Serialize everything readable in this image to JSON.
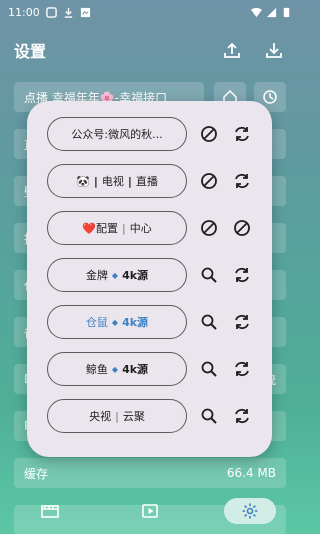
{
  "status_bar": {
    "time": "11:00"
  },
  "header": {
    "title": "设置"
  },
  "settings_rows": [
    {
      "label": "点播     幸福年年🌸-幸福接口"
    },
    {
      "label": "直"
    },
    {
      "label": "壁"
    },
    {
      "label": "推"
    },
    {
      "label": "代"
    },
    {
      "label": "备"
    },
    {
      "label": "D",
      "value": "统"
    },
    {
      "label": "P"
    },
    {
      "label": "缓存",
      "value": "66.4 MB"
    }
  ],
  "modal": {
    "items": [
      {
        "name": "公众号:微风的秋..."
      },
      {
        "prefix": "🐼",
        "name": "电视",
        "suffix": "直播"
      },
      {
        "prefix": "❤️",
        "name": "配置",
        "suffix": "中心"
      },
      {
        "name": "金牌",
        "tag": "4k源"
      },
      {
        "name": "仓鼠",
        "tag": "4k源",
        "active": true
      },
      {
        "name": "鲸鱼",
        "tag": "4k源"
      },
      {
        "name": "央视",
        "suffix": "云聚"
      }
    ]
  },
  "colors": {
    "accent": "#3d82c4",
    "modal_bg": "#ebe5ee",
    "nav_active_bg": "#d2ece6"
  }
}
